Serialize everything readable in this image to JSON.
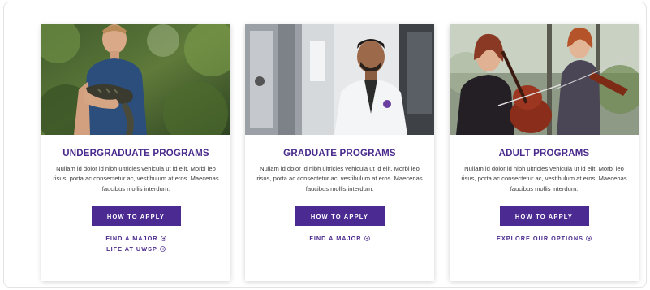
{
  "colors": {
    "accent": "#4b2a91",
    "heading": "#4a2a8c",
    "body_text": "#3d3d3d"
  },
  "cards": [
    {
      "title": "UNDERGRADUATE PROGRAMS",
      "description": "Nullam id dolor id nibh ultricies vehicula ut id elit. Morbi leo risus, porta ac consectetur ac, vestibulum at eros. Maecenas faucibus mollis interdum.",
      "button_label": "HOW TO APPLY",
      "links": [
        "FIND A MAJOR",
        "LIFE AT UWSP"
      ]
    },
    {
      "title": "GRADUATE PROGRAMS",
      "description": "Nullam id dolor id nibh ultricies vehicula ut id elit. Morbi leo risus, porta ac consectetur ac, vestibulum at eros. Maecenas faucibus mollis interdum.",
      "button_label": "HOW TO APPLY",
      "links": [
        "FIND A MAJOR"
      ]
    },
    {
      "title": "ADULT PROGRAMS",
      "description": "Nullam id dolor id nibh ultricies vehicula ut id elit. Morbi leo risus, porta ac consectetur ac, vestibulum at eros. Maecenas faucibus mollis interdum.",
      "button_label": "HOW TO APPLY",
      "links": [
        "EXPLORE OUR OPTIONS"
      ]
    }
  ]
}
